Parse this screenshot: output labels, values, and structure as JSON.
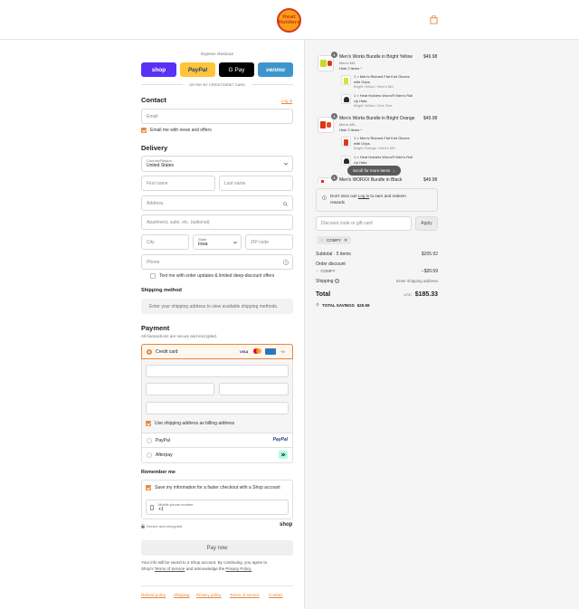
{
  "header": {
    "logo_line1": "Heat",
    "logo_line2": "Holders"
  },
  "express": {
    "title": "Express checkout",
    "shop": "shop",
    "paypal": "PayPal",
    "gpay": "G Pay",
    "venmo": "venmo",
    "or": "OR PAY BY CREDIT/DEBIT CARD"
  },
  "contact": {
    "heading": "Contact",
    "login": "Log in",
    "email_placeholder": "Email",
    "news_label": "Email me with news and offers"
  },
  "delivery": {
    "heading": "Delivery",
    "country_label": "Country/Region",
    "country_value": "United States",
    "first_name": "First name",
    "last_name": "Last name",
    "address": "Address",
    "apartment": "Apartment, suite, etc. (optional)",
    "city": "City",
    "state_label": "State",
    "state_value": "Iowa",
    "zip": "ZIP code",
    "phone": "Phone",
    "text_label": "Text me with order updates & limited deep-discount offers"
  },
  "shipping": {
    "heading": "Shipping method",
    "note": "Enter your shipping address to view available shipping methods."
  },
  "payment": {
    "heading": "Payment",
    "subtitle": "All transactions are secure and encrypted.",
    "credit_card": "Credit card",
    "visa": "VISA",
    "more_cards": "+5",
    "billing_label": "Use shipping address as billing address",
    "paypal": "PayPal",
    "paypal_logo": "PayPal",
    "afterpay": "Afterpay"
  },
  "remember": {
    "heading": "Remember me",
    "save_label": "Save my information for a faster checkout with a Shop account",
    "mobile_label": "Mobile phone number",
    "mobile_value": "+1",
    "secure": "Secure and encrypted",
    "shop": "shop"
  },
  "pay_now": "Pay now",
  "legal": {
    "line1": "Your info will be saved to a Shop account. By continuing, you agree to",
    "line2_a": "Shop's",
    "terms": "Terms of Service",
    "line2_b": "and acknowledge the",
    "privacy": "Privacy Policy."
  },
  "footer": [
    "Refund policy",
    "Shipping",
    "Privacy policy",
    "Terms of service",
    "Contact"
  ],
  "cart": {
    "items": [
      {
        "qty": "1",
        "title": "Men's Works Bundle in Bright Yellow",
        "size": "Men's M/L",
        "hide": "Hide 2 items",
        "price": "$49.98",
        "sub": [
          {
            "title1": "1 × Men's Richard Flat Knit Gloves",
            "title2": "with Grips",
            "variant": "Bright Yellow / Men's M/L"
          },
          {
            "title1": "1 × Heat Holders Worxx® Men's Roll",
            "title2": "Up Hats",
            "variant": "Bright Yellow / One Size"
          }
        ]
      },
      {
        "qty": "1",
        "title": "Men's Works Bundle in Bright Orange",
        "size": "Men's M/L",
        "hide": "Hide 2 items",
        "price": "$49.98",
        "sub": [
          {
            "title1": "1 × Men's Richard Flat Knit Gloves",
            "title2": "with Grips",
            "variant": "Bright Orange / Men's M/L"
          },
          {
            "title1": "1 × Heat Holders Worxx® Men's Roll",
            "title2": "Up Hats",
            "variant": ""
          }
        ]
      },
      {
        "qty": "1",
        "title": "Men's WORXX Bundle in Black",
        "price": "$49.98"
      }
    ],
    "scroll_hint": "Scroll for more items",
    "rewards": {
      "text1": "Don't miss out!",
      "login": "Log in",
      "text2": "to earn and redeem",
      "text3": "rewards"
    },
    "discount_placeholder": "Discount code or gift card",
    "apply": "Apply",
    "code": "COMFY",
    "subtotal_label": "Subtotal · 5 items",
    "subtotal": "$205.92",
    "order_discount": "Order discount",
    "discount_code": "COMFY",
    "discount_value": "−$20.59",
    "shipping_label": "Shipping",
    "shipping_value": "Enter shipping address",
    "total_label": "Total",
    "currency": "USD",
    "total": "$185.33",
    "savings_label": "TOTAL SAVINGS",
    "savings": "$20.59"
  }
}
